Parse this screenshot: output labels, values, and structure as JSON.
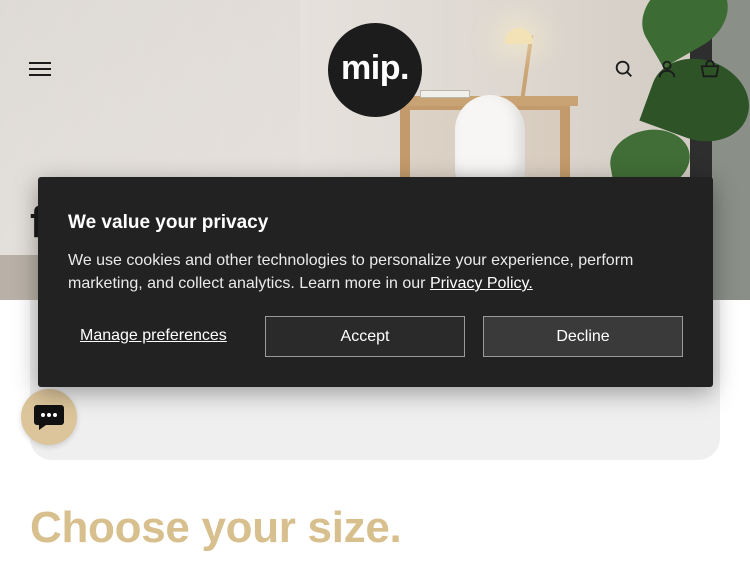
{
  "header": {
    "logo_text": "mip.",
    "menu_icon": "hamburger-menu-icon",
    "search_icon": "search-icon",
    "account_icon": "user-account-icon",
    "cart_icon": "cart-basket-icon"
  },
  "hero": {
    "partial_heading": "f"
  },
  "privacy_banner": {
    "title": "We value your privacy",
    "body": "We use cookies and other technologies to personalize your experience, perform marketing, and collect analytics. Learn more in our ",
    "policy_link": "Privacy Policy.",
    "manage_label": "Manage preferences",
    "accept_label": "Accept",
    "decline_label": "Decline"
  },
  "chat": {
    "icon": "chat-bubble-icon"
  },
  "main": {
    "heading": "Choose your size."
  },
  "colors": {
    "accent": "#d8bf8e",
    "banner_bg": "#222222",
    "logo_bg": "#1c1c1c"
  }
}
